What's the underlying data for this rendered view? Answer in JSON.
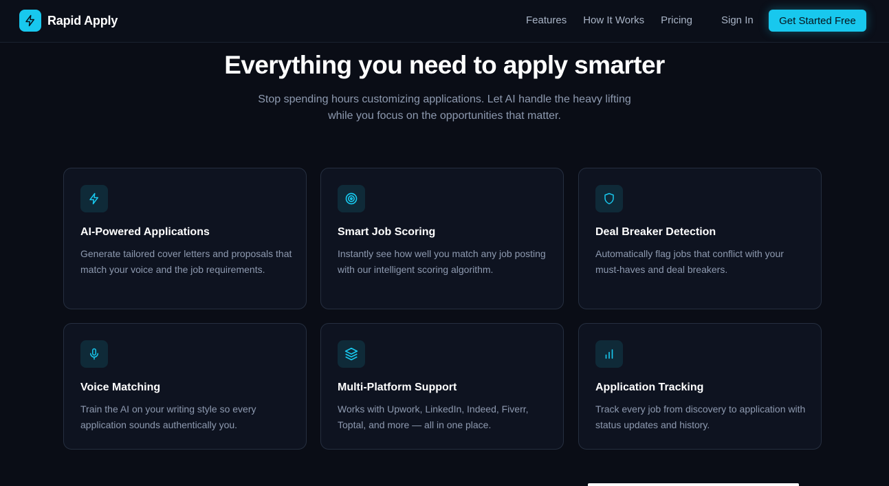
{
  "brand": {
    "name": "Rapid Apply",
    "icon": "lightning-icon",
    "accent": "#18c8ee"
  },
  "nav": {
    "links": [
      "Features",
      "How It Works",
      "Pricing"
    ],
    "sign_in": "Sign In",
    "cta": "Get Started Free"
  },
  "hero": {
    "title": "Everything you need to apply smarter",
    "subtitle": "Stop spending hours customizing applications. Let AI handle the heavy lifting while you focus on the opportunities that matter."
  },
  "features": [
    {
      "icon": "lightning-icon",
      "title": "AI-Powered Applications",
      "description": "Generate tailored cover letters and proposals that match your voice and the job requirements."
    },
    {
      "icon": "target-icon",
      "title": "Smart Job Scoring",
      "description": "Instantly see how well you match any job posting with our intelligent scoring algorithm."
    },
    {
      "icon": "shield-icon",
      "title": "Deal Breaker Detection",
      "description": "Automatically flag jobs that conflict with your must-haves and deal breakers."
    },
    {
      "icon": "microphone-icon",
      "title": "Voice Matching",
      "description": "Train the AI on your writing style so every application sounds authentically you."
    },
    {
      "icon": "layers-icon",
      "title": "Multi-Platform Support",
      "description": "Works with Upwork, LinkedIn, Indeed, Fiverr, Toptal, and more — all in one place."
    },
    {
      "icon": "bar-chart-icon",
      "title": "Application Tracking",
      "description": "Track every job from discovery to application with status updates and history."
    }
  ]
}
